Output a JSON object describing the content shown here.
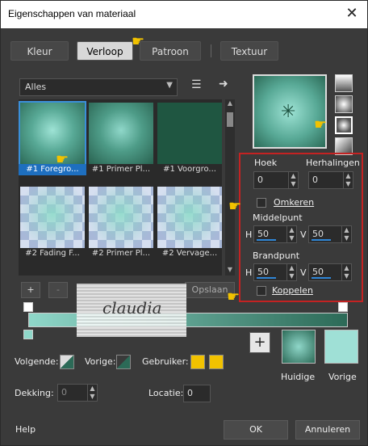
{
  "window": {
    "title": "Eigenschappen van materiaal",
    "close": "✕"
  },
  "tabs": [
    {
      "label": "Kleur"
    },
    {
      "label": "Verloop"
    },
    {
      "label": "Patroon"
    },
    {
      "label": "Textuur"
    }
  ],
  "filter": {
    "selected": "Alles"
  },
  "thumbnails": [
    {
      "label": "#1 Foregro..."
    },
    {
      "label": "#1 Primer Pl..."
    },
    {
      "label": "#1 Voorgro..."
    },
    {
      "label": "#2 Fading F..."
    },
    {
      "label": "#2 Primer Pl..."
    },
    {
      "label": "#2 Vervage..."
    }
  ],
  "settings": {
    "angle_label": "Hoek",
    "angle_value": "0",
    "repeats_label": "Herhalingen",
    "repeats_value": "0",
    "invert_label": "Omkeren",
    "center_label": "Middelpunt",
    "h_label": "H",
    "v_label": "V",
    "center_h": "50",
    "center_v": "50",
    "focal_label": "Brandpunt",
    "focal_h": "50",
    "focal_v": "50",
    "link_label": "Koppelen"
  },
  "editor": {
    "add": "+",
    "remove": "-",
    "save_label": "Opslaan"
  },
  "watermark": {
    "text": "claudia"
  },
  "bottom": {
    "next_label": "Volgende:",
    "prev_label": "Vorige:",
    "user_label": "Gebruiker:",
    "opacity_label": "Dekking:",
    "opacity_value": "0",
    "location_label": "Locatie:",
    "location_value": "0",
    "add_label": "+",
    "current_label": "Huidige",
    "previous_label": "Vorige"
  },
  "footer": {
    "help": "Help",
    "ok": "OK",
    "cancel": "Annuleren"
  },
  "colors": {
    "accent": "#c42222",
    "selection": "#1e6fbf",
    "gradient_light": "#8fd7c9",
    "gradient_dark": "#2c6a57",
    "user_swatch": "#f2c200"
  }
}
